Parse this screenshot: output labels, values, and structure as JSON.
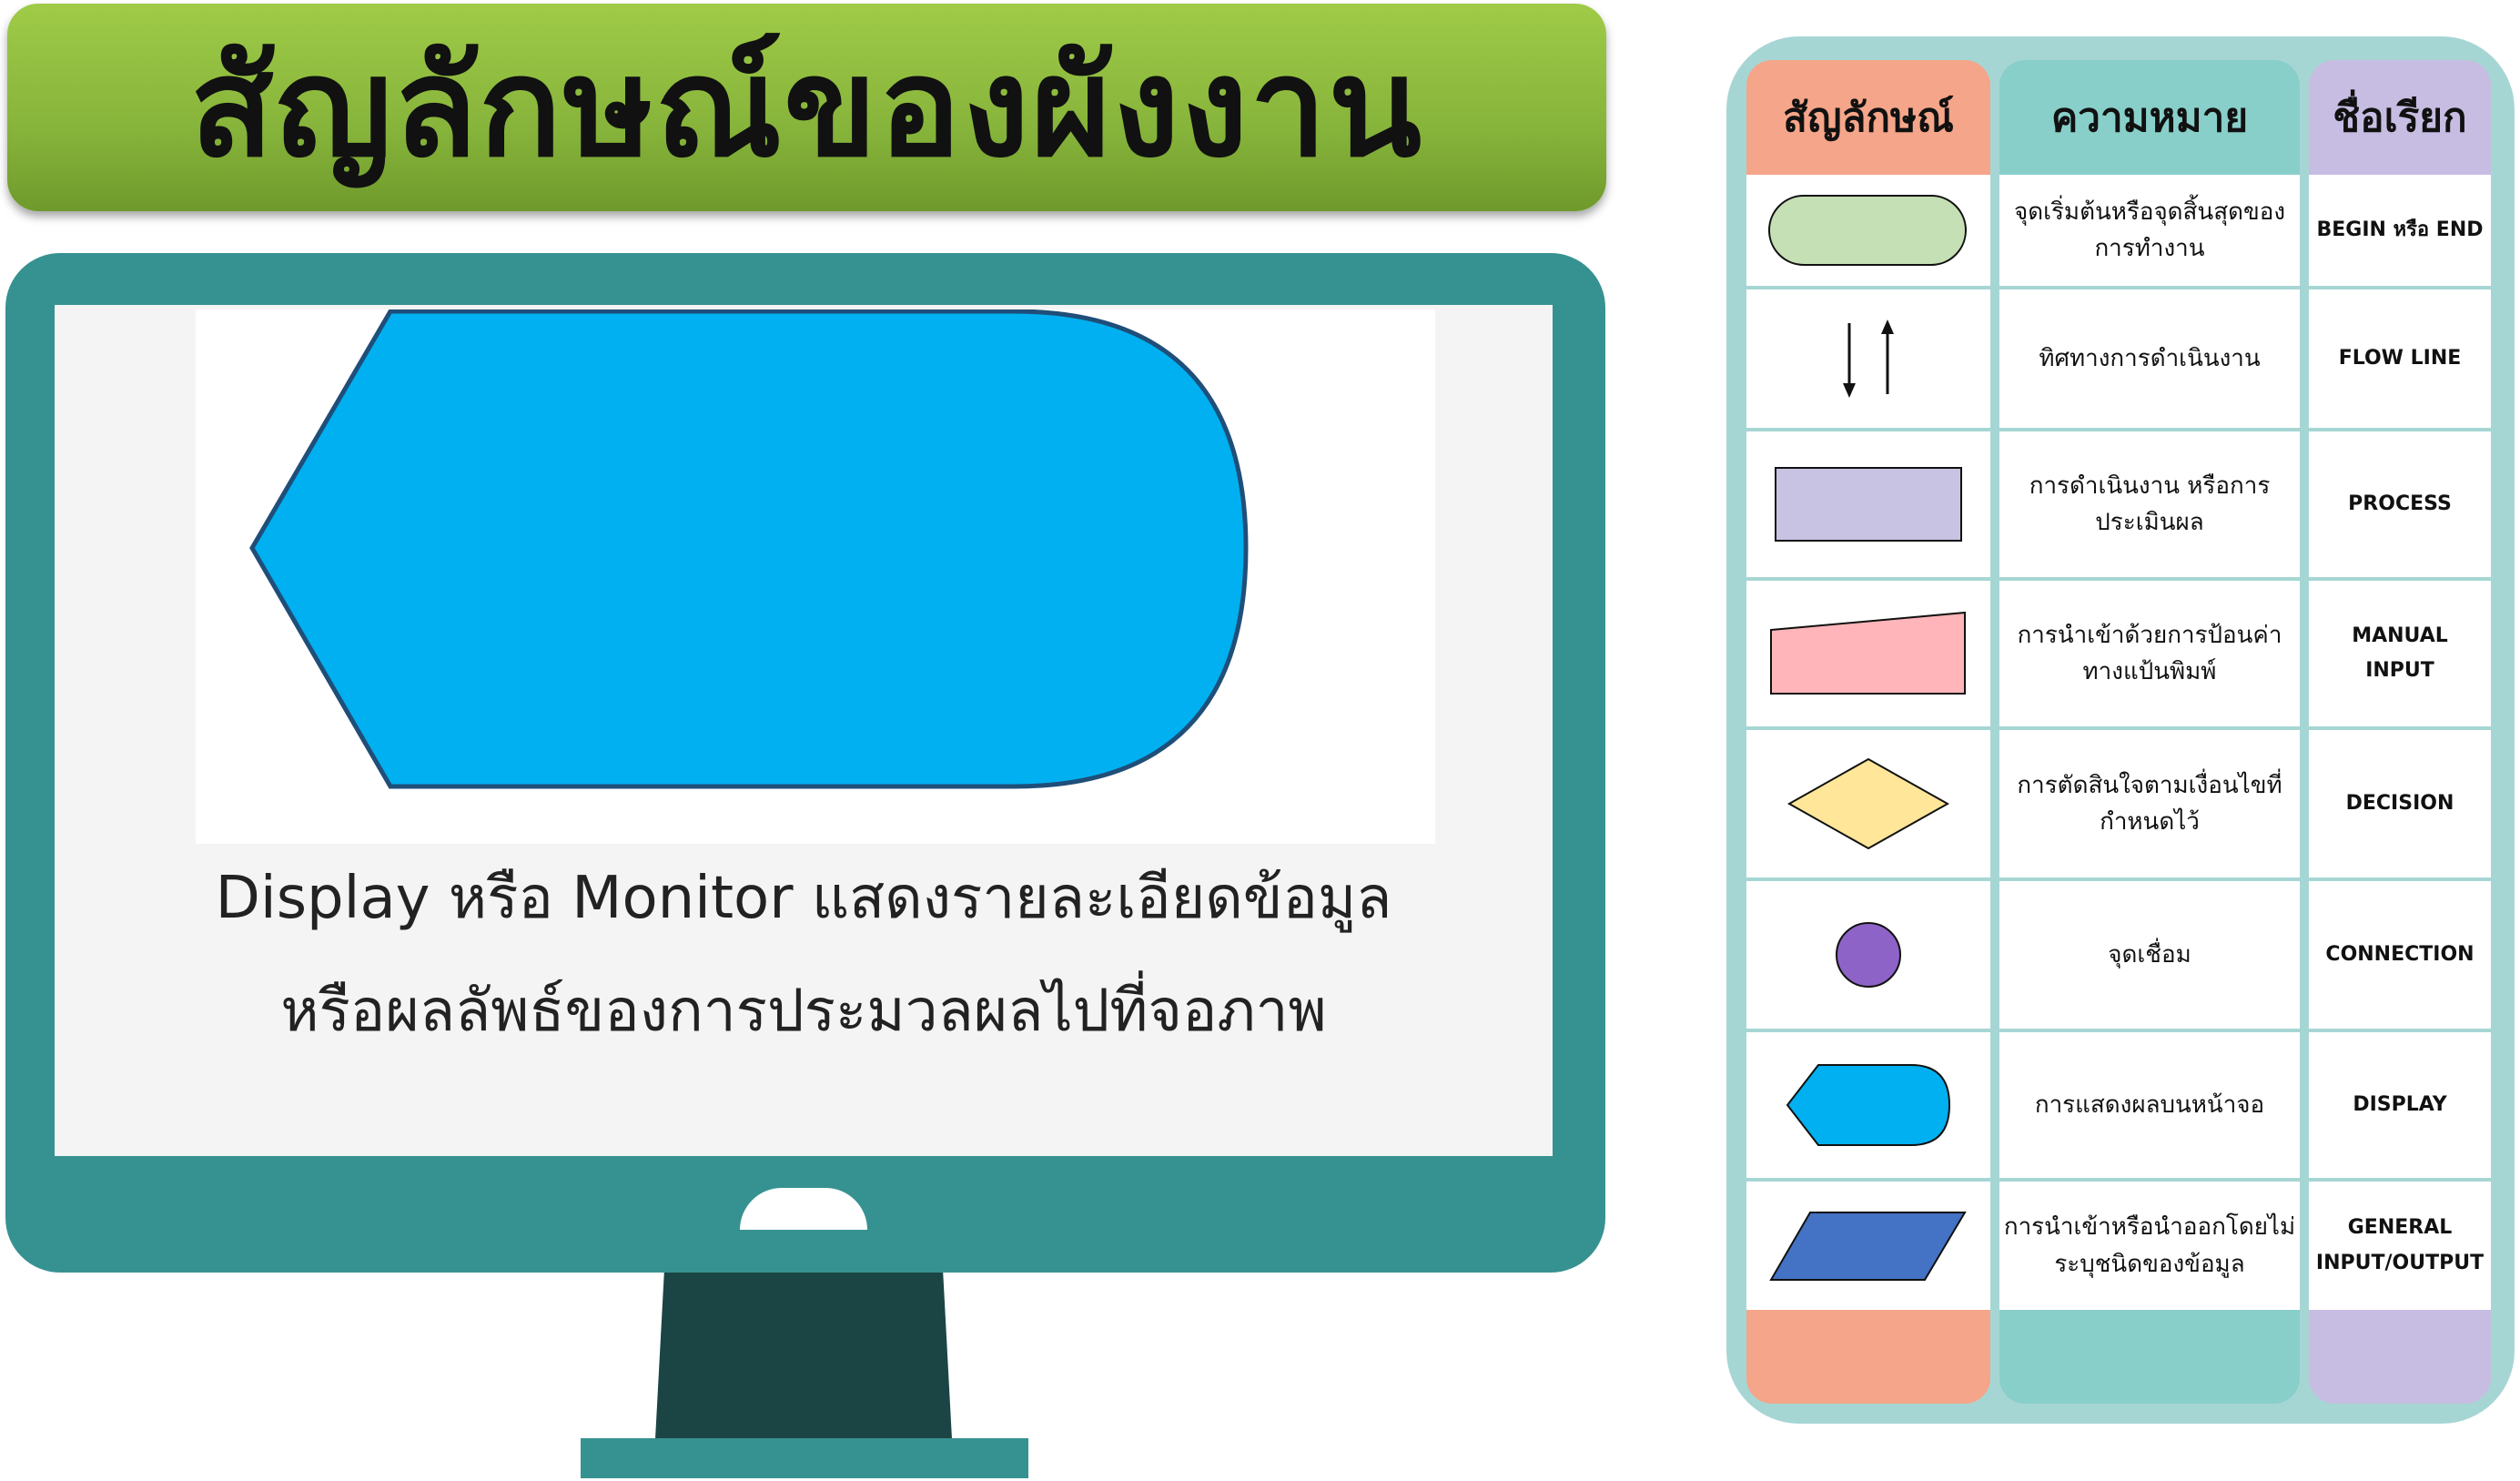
{
  "title": "สัญลักษณ์ของผังงาน",
  "monitor": {
    "caption_line1": "Display หรือ Monitor แสดงรายละเอียดข้อมูล",
    "caption_line2": "หรือผลลัพธ์ของการประมวลผลไปที่จอภาพ",
    "featured_symbol_icon": "display-symbol-icon",
    "featured_symbol_color": "#00b0f0"
  },
  "table": {
    "headers": {
      "symbol": "สัญลักษณ์",
      "meaning": "ความหมาย",
      "name": "ชื่อเรียก"
    },
    "rows": [
      {
        "icon": "terminator-icon",
        "meaning": "จุดเริ่มต้นหรือจุดสิ้นสุดของ\nการทำงาน",
        "name": "BEGIN หรือ END"
      },
      {
        "icon": "flow-line-arrows-icon",
        "meaning": "ทิศทางการดำเนินงาน",
        "name": "FLOW LINE"
      },
      {
        "icon": "process-rectangle-icon",
        "meaning": "การดำเนินงาน หรือการ\nประเมินผล",
        "name": "PROCESS"
      },
      {
        "icon": "manual-input-icon",
        "meaning": "การนำเข้าด้วยการป้อนค่า\nทางแป้นพิมพ์",
        "name": "MANUAL\nINPUT"
      },
      {
        "icon": "decision-diamond-icon",
        "meaning": "การตัดสินใจตามเงื่อนไขที่\nกำหนดไว้",
        "name": "DECISION"
      },
      {
        "icon": "connector-circle-icon",
        "meaning": "จุดเชื่อม",
        "name": "CONNECTION"
      },
      {
        "icon": "display-symbol-icon",
        "meaning": "การแสดงผลบนหน้าจอ",
        "name": "DISPLAY"
      },
      {
        "icon": "input-output-parallelogram-icon",
        "meaning": "การนำเข้าหรือนำออกโดยไม่\nระบุชนิดของข้อมูล",
        "name": "GENERAL\nINPUT/OUTPUT"
      }
    ]
  },
  "colors": {
    "title_green": "#8fbe40",
    "monitor_teal": "#369290",
    "stand_dark": "#1b4544",
    "card_bg": "#a6d6d4",
    "header_symbol": "#f5a589",
    "header_meaning": "#88cfca",
    "header_name": "#c7bde2",
    "terminator_fill": "#c5e0b4",
    "process_fill": "#c8c3e2",
    "manual_input_fill": "#ffb5b9",
    "decision_fill": "#ffe699",
    "connector_fill": "#8e63c7",
    "display_fill": "#00b0f0",
    "io_fill": "#4472c4"
  }
}
